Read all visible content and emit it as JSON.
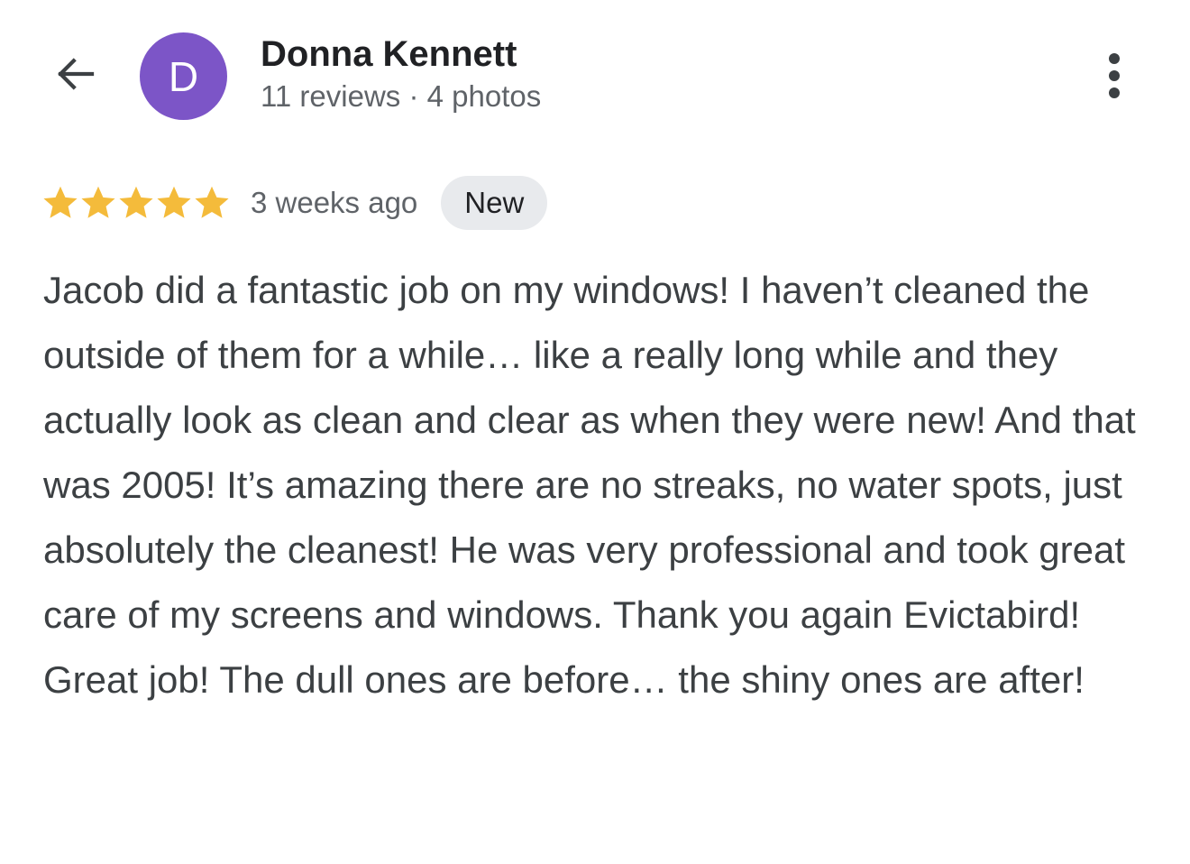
{
  "header": {
    "back_icon": "arrow-left-icon",
    "avatar_initial": "D",
    "avatar_color": "#7c55c7",
    "reviewer_name": "Donna Kennett",
    "reviewer_meta": "11 reviews · 4 photos",
    "more_icon": "more-vertical-icon"
  },
  "review": {
    "rating": 5,
    "rating_max": 5,
    "star_color": "#f4bb3b",
    "date": "3 weeks ago",
    "badge": "New",
    "text": "Jacob did a fantastic job on my windows! I haven’t cleaned the outside of them for a while… like a really long while and they actually look as clean and clear as when they were new! And that was 2005! It’s amazing there are no streaks, no water spots, just absolutely the cleanest! He was very professional and took great care of my screens and windows. Thank you again Evictabird! Great job! The dull ones are before… the shiny ones are after!"
  }
}
